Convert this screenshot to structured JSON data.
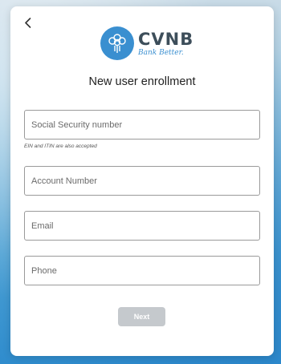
{
  "logo": {
    "name": "CVNB",
    "tagline": "Bank Better."
  },
  "heading": "New user enrollment",
  "fields": {
    "ssn": {
      "placeholder": "Social Security number",
      "value": "",
      "hint": "EIN and ITIN are also accepted"
    },
    "account": {
      "placeholder": "Account Number",
      "value": ""
    },
    "email": {
      "placeholder": "Email",
      "value": ""
    },
    "phone": {
      "placeholder": "Phone",
      "value": ""
    }
  },
  "next_button": {
    "label": "Next",
    "state": "disabled"
  },
  "colors": {
    "brand_blue": "#3a8fd0",
    "logo_text": "#3d4e5a",
    "button_disabled": "#c5c9cd"
  },
  "icons": {
    "back": "chevron-left-icon",
    "logo": "tree-icon"
  }
}
